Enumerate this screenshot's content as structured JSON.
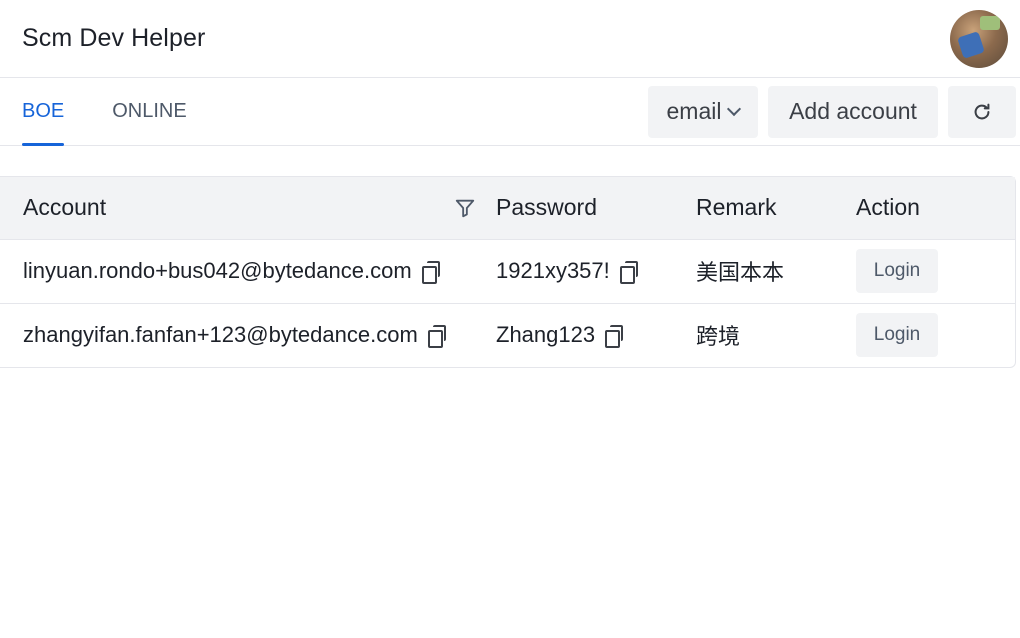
{
  "header": {
    "title": "Scm Dev Helper"
  },
  "tabs": [
    {
      "label": "BOE",
      "active": true
    },
    {
      "label": "ONLINE",
      "active": false
    }
  ],
  "toolbar": {
    "email_select": "email",
    "add_account_label": "Add account",
    "refresh_icon": "refresh-icon"
  },
  "table": {
    "columns": [
      "Account",
      "Password",
      "Remark",
      "Action"
    ],
    "rows": [
      {
        "account": "linyuan.rondo+bus042@bytedance.com",
        "password": "1921xy357!",
        "remark": "美国本本",
        "action": "Login"
      },
      {
        "account": "zhangyifan.fanfan+123@bytedance.com",
        "password": "Zhang123",
        "remark": "跨境",
        "action": "Login"
      }
    ]
  },
  "colors": {
    "accent": "#1664d9",
    "button_bg": "#f2f3f5",
    "border": "#e5e6eb"
  }
}
